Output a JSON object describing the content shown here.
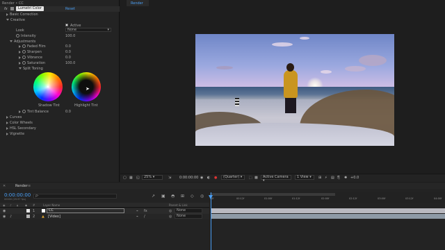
{
  "effect_controls": {
    "panel_title": "Render • CC",
    "fx_badge": "fx",
    "effect_name": "Lumetri Color",
    "reset_label": "Reset",
    "sections": {
      "basic_correction": "Basic Correction",
      "creative": "Creative",
      "curves": "Curves",
      "color_wheels": "Color Wheels",
      "hsl_secondary": "HSL Secondary",
      "vignette": "Vignette"
    },
    "active_label": "Active",
    "look_label": "Look",
    "look_value": "None",
    "intensity_label": "Intensity",
    "intensity_value": "100.0",
    "adjustments_label": "Adjustments",
    "adjustments": [
      {
        "label": "Faded Film",
        "value": "0.0"
      },
      {
        "label": "Sharpen",
        "value": "0.0"
      },
      {
        "label": "Vibrance",
        "value": "0.0"
      },
      {
        "label": "Saturation",
        "value": "100.0"
      }
    ],
    "split_toning_label": "Split Toning",
    "shadow_tint_label": "Shadow Tint",
    "highlight_tint_label": "Highlight Tint",
    "tint_balance_label": "Tint Balance",
    "tint_balance_value": "0.0"
  },
  "viewer": {
    "tab_label": "Render",
    "zoom": "25%",
    "timecode": "0:00:00:00",
    "resolution": "(Quarter)",
    "camera": "Active Camera",
    "views": "1 View",
    "exposure": "+0.0"
  },
  "timeline": {
    "tab_label": "Render",
    "current_time": "0:00:00:00",
    "frame_info": "00000 (29.97 fps)",
    "search_placeholder": "ρ-",
    "columns": {
      "layer_name": "Layer Name",
      "parent": "Parent & Link"
    },
    "layers": [
      {
        "number": "1",
        "name": "CC",
        "parent": "None",
        "label_color": "#ffffff"
      },
      {
        "number": "2",
        "name": "[Video]",
        "parent": "None",
        "label_color": "#b8b8b8"
      }
    ],
    "ruler_labels": [
      "0f",
      "00:12f",
      "01:00f",
      "01:12f",
      "02:00f",
      "02:12f",
      "03:00f",
      "03:12f",
      "04:00f"
    ]
  },
  "colors": {
    "accent": "#4a9ff5",
    "panel_bg": "#232323"
  }
}
